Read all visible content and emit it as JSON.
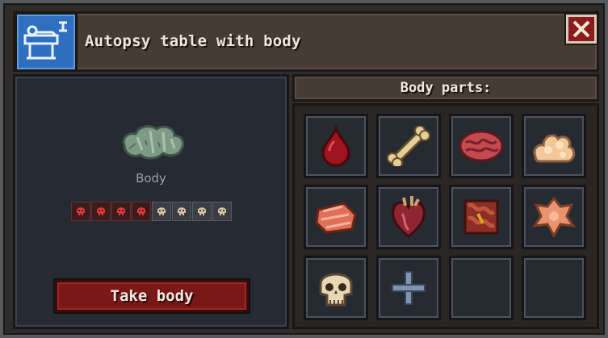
{
  "window": {
    "title": "Autopsy table with body",
    "title_icon": "autopsy-table-blueprint-icon",
    "close_icon": "close-x-icon"
  },
  "body_panel": {
    "body_icon": "wrapped-body-icon",
    "label": "Body",
    "health": {
      "filled": 4,
      "total": 8,
      "filled_icon": "red-skull-icon",
      "empty_icon": "beige-skull-icon"
    },
    "take_button": "Take body"
  },
  "parts": {
    "header": "Body parts:",
    "slots": [
      {
        "icon": "blood-drop-icon"
      },
      {
        "icon": "bone-icon"
      },
      {
        "icon": "brain-icon"
      },
      {
        "icon": "fat-icon"
      },
      {
        "icon": "meat-icon"
      },
      {
        "icon": "heart-icon"
      },
      {
        "icon": "intestines-icon"
      },
      {
        "icon": "skin-icon"
      },
      {
        "icon": "skull-icon"
      },
      {
        "icon": "add-plus-icon"
      },
      {
        "icon": ""
      },
      {
        "icon": ""
      }
    ]
  },
  "colors": {
    "accent_red": "#7a1717",
    "title_bar": "#463b35",
    "panel_dark": "#252a33"
  }
}
